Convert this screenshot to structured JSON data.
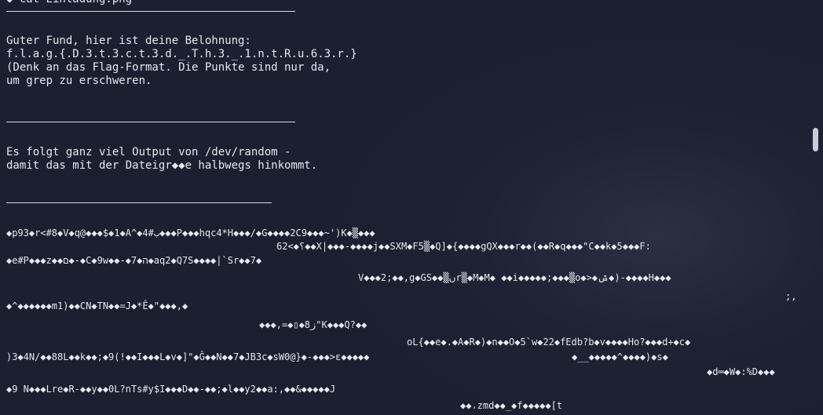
{
  "terminal": {
    "header_partial": "◆ cat Einladung.png"
  },
  "message": {
    "line1": "Guter Fund, hier ist deine Belohnung:",
    "line2": "f.l.a.g.{.D.3.t.3.c.t.3.d._.T.h.3._.1.n.t.R.u.6.3.r.}",
    "line3": "(Denk an das Flag-Format. Die Punkte sind nur da,",
    "line4": "um grep zu erschweren."
  },
  "filler": {
    "line1": "Es folgt ganz viel Output von /dev/random -",
    "line2": "damit das mit der Dateigr◆◆e halbwegs hinkommt."
  },
  "random_output": [
    "◆p93◆r<#8◆V◆q@◆◆◆$◆1◆A^◆4#ب◆◆◆P◆◆◆hqc4*H◆◆◆/◆G◆◆◆◆2C9◆◆◆~')K◆▒◆◆◆",
    "62<◆؟◆◆X|◆◆◆-◆◆◆◆j◆◆SXM◆F5▒◆Q]◆{◆◆◆◆gQX◆◆◆r◆◆(◆◆R◆q◆◆◆\"C◆◆k◆5◆◆◆F:",
    "◆e#P◆◆◆z◆◆ם◆-◆C◆9w◆◆-◆7◆ה◆aq2◆Q7S◆◆◆◆|`Sr◆◆7◆",
    "V◆◆◆2;◆◆,g◆GS◆◆▒ںr▒◆M◆M◆ ◆◆i◆◆◆◆◆;◆◆◆▒o◆>◆ݜ◆)-◆◆◆◆H◆◆◆",
    ";,",
    "◆^◆◆◆◆◆◆m1)◆◆CN◆TN◆◆=J◆*Ê◆\"◆◆◆,◆",
    "◆◆◆,=◆▯◆8ز\"K◆◆◆Q?◆◆",
    "oL{◆◆e◆.◆A◆R◆)◆n◆◆O◆5`w◆22◆fEdb?b◆v◆◆◆◆Ho?◆◆◆d+◆c◆",
    ")3◆4N/◆◆88L◆◆k◆◆;◆9(!◆◆I◆◆◆L◆v◆]\"◆Ĝ◆◆N◆◆7◆JB3c◆sW0@}◆-◆◆◆>ε◆◆◆◆◆",
    "◆__◆◆◆◆◆^◆◆◆◆)◆s◆",
    "◆d═◆W◆:%D◆◆◆",
    "◆9 N◆◆◆Lre◆R-◆◆y◆◆0L?nTs#y$I◆◆◆D◆◆-◆◆;◆l◆◆y2◆◆a:,◆◆&◆◆◆◆◆J",
    "◆◆،zmd◆◆_◆f◆◆◆◆◆[t"
  ]
}
